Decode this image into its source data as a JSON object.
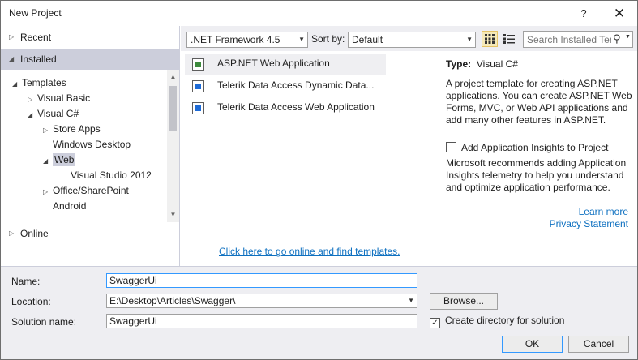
{
  "window": {
    "title": "New Project",
    "help_label": "?",
    "close_label": "✕"
  },
  "nav": {
    "recent": "Recent",
    "installed": "Installed",
    "online": "Online",
    "tree": [
      {
        "label": "Templates",
        "arrow": "◢"
      },
      {
        "label": "Visual Basic",
        "arrow": "▷"
      },
      {
        "label": "Visual C#",
        "arrow": "◢"
      },
      {
        "label": "Store Apps",
        "arrow": "▷"
      },
      {
        "label": "Windows Desktop",
        "arrow": ""
      },
      {
        "label": "Web",
        "arrow": "◢"
      },
      {
        "label": "Visual Studio 2012",
        "arrow": ""
      },
      {
        "label": "Office/SharePoint",
        "arrow": "▷"
      },
      {
        "label": "Android",
        "arrow": ""
      }
    ]
  },
  "toolbar": {
    "framework": ".NET Framework 4.5",
    "sort_label": "Sort by:",
    "sort_value": "Default",
    "search_placeholder": "Search Installed Templates"
  },
  "templates": [
    {
      "name": "ASP.NET Web Application",
      "icon": "aspnet-web-icon"
    },
    {
      "name": "Telerik Data Access Dynamic Data...",
      "icon": "telerik-icon"
    },
    {
      "name": "Telerik Data Access Web Application",
      "icon": "telerik-icon"
    }
  ],
  "online_link": "Click here to go online and find templates.",
  "description": {
    "type_label": "Type:",
    "type_value": "Visual C#",
    "text": "A project template for creating ASP.NET applications. You can create ASP.NET Web Forms, MVC,  or Web API applications and add many other features in ASP.NET.",
    "ai_checkbox": "Add Application Insights to Project",
    "ai_text": "Microsoft recommends adding Application Insights telemetry to help you understand and optimize application performance.",
    "learn_more": "Learn more",
    "privacy": "Privacy Statement"
  },
  "form": {
    "name_label": "Name:",
    "name_value": "SwaggerUi",
    "location_label": "Location:",
    "location_value": "E:\\Desktop\\Articles\\Swagger\\",
    "solution_label": "Solution name:",
    "solution_value": "SwaggerUi",
    "browse_label": "Browse...",
    "create_dir_label": "Create directory for solution",
    "create_dir_checked": "✓",
    "ok_label": "OK",
    "cancel_label": "Cancel"
  }
}
